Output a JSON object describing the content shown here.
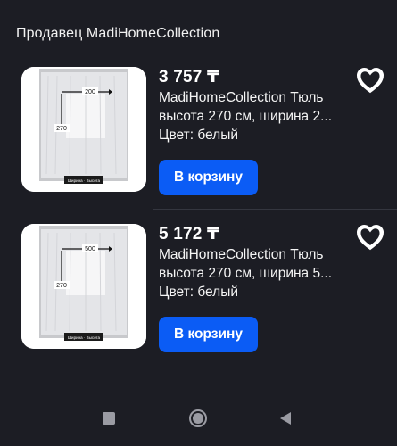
{
  "seller": {
    "title": "Продавец MadiHomeCollection"
  },
  "products": [
    {
      "price": "3 757 ₸",
      "desc_line1": "MadiHomeCollection Тюль",
      "desc_line2": "высота 270 см, ширина 2...",
      "color": "Цвет: белый",
      "button_label": "В корзину",
      "image": {
        "width_label": "200",
        "height_label": "270",
        "caption": "Ширина · Высота"
      },
      "favorite": true
    },
    {
      "price": "5 172 ₸",
      "desc_line1": "MadiHomeCollection Тюль",
      "desc_line2": "высота 270 см, ширина 5...",
      "color": "Цвет: белый",
      "button_label": "В корзину",
      "image": {
        "width_label": "500",
        "height_label": "270",
        "caption": "Ширина · Высота"
      },
      "favorite": true
    }
  ],
  "colors": {
    "background": "#1c1d24",
    "button": "#0b5cf5",
    "text": "#ffffff"
  },
  "nav": {
    "icons": [
      "recent-apps-icon",
      "home-icon",
      "back-icon"
    ]
  }
}
